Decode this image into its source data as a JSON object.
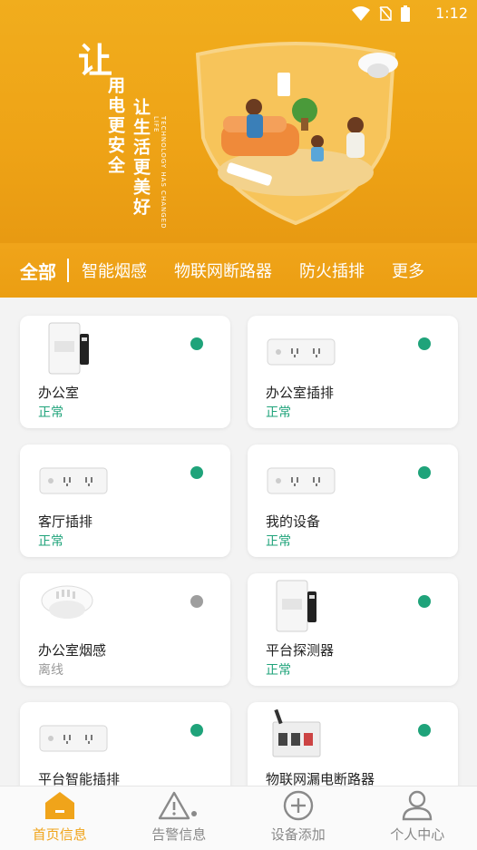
{
  "status_bar": {
    "time": "1:12"
  },
  "banner": {
    "slogan_main": "让",
    "slogan_line1": "用电更安全",
    "slogan_line2": "让生活更美好",
    "slogan_en": "TECHNOLOGY HAS CHANGED LIFE"
  },
  "tabs": [
    {
      "label": "全部",
      "active": true
    },
    {
      "label": "智能烟感"
    },
    {
      "label": "物联网断路器"
    },
    {
      "label": "防火插排"
    },
    {
      "label": "更多"
    }
  ],
  "devices": [
    {
      "name": "办公室",
      "status": "正常",
      "online": true,
      "type": "breaker"
    },
    {
      "name": "办公室插排",
      "status": "正常",
      "online": true,
      "type": "strip"
    },
    {
      "name": "客厅插排",
      "status": "正常",
      "online": true,
      "type": "strip"
    },
    {
      "name": "我的设备",
      "status": "正常",
      "online": true,
      "type": "strip"
    },
    {
      "name": "办公室烟感",
      "status": "离线",
      "online": false,
      "type": "smoke"
    },
    {
      "name": "平台探测器",
      "status": "正常",
      "online": true,
      "type": "breaker"
    },
    {
      "name": "平台智能插排",
      "status": "",
      "online": true,
      "type": "strip"
    },
    {
      "name": "物联网漏电断路器",
      "status": "",
      "online": true,
      "type": "leakbreaker"
    }
  ],
  "colors": {
    "accent": "#f0a41a",
    "online": "#1fa37a",
    "offline": "#9e9e9e",
    "status_ok": "#1fa37a",
    "status_off": "#999999"
  },
  "nav": [
    {
      "label": "首页信息",
      "icon": "home-icon",
      "active": true
    },
    {
      "label": "告警信息",
      "icon": "alert-icon"
    },
    {
      "label": "设备添加",
      "icon": "add-circle-icon"
    },
    {
      "label": "个人中心",
      "icon": "user-icon"
    }
  ]
}
